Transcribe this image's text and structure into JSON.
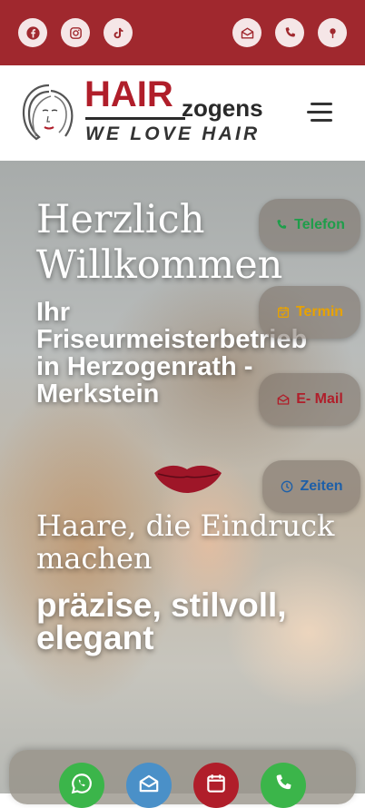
{
  "topbar": {
    "social_icons": [
      "facebook-icon",
      "instagram-icon",
      "tiktok-icon"
    ],
    "contact_icons": [
      "email-icon",
      "phone-icon",
      "location-icon"
    ],
    "background": "#a0282e",
    "icon_color": "#a0282e"
  },
  "header": {
    "logo": {
      "brand_main": "HAIR",
      "brand_sub": "zogens",
      "tagline": "WE LOVE HAIR"
    },
    "menu_icon": "hamburger-menu-icon"
  },
  "hero": {
    "title": "Herzlich Willkommen",
    "subtitle": "Ihr Friseurmeisterbetrieb in Herzogenrath - Merkstein",
    "tagline": "Haare, die Eindruck machen",
    "claim": "präzise, stilvoll, elegant"
  },
  "side_buttons": [
    {
      "label": "Telefon",
      "icon": "phone-icon",
      "color": "#1e9e4a"
    },
    {
      "label": "Termin",
      "icon": "calendar-check-icon",
      "color": "#e8a200"
    },
    {
      "label": "E- Mail",
      "icon": "email-icon",
      "color": "#b01e2a"
    },
    {
      "label": "Zeiten",
      "icon": "clock-icon",
      "color": "#1d5fa8"
    }
  ],
  "dock": {
    "buttons": [
      {
        "icon": "whatsapp-icon",
        "color": "#3bb54a"
      },
      {
        "icon": "email-icon",
        "color": "#4a90c8"
      },
      {
        "icon": "calendar-icon",
        "color": "#b01e2a"
      },
      {
        "icon": "phone-icon",
        "color": "#3bb54a"
      }
    ]
  }
}
